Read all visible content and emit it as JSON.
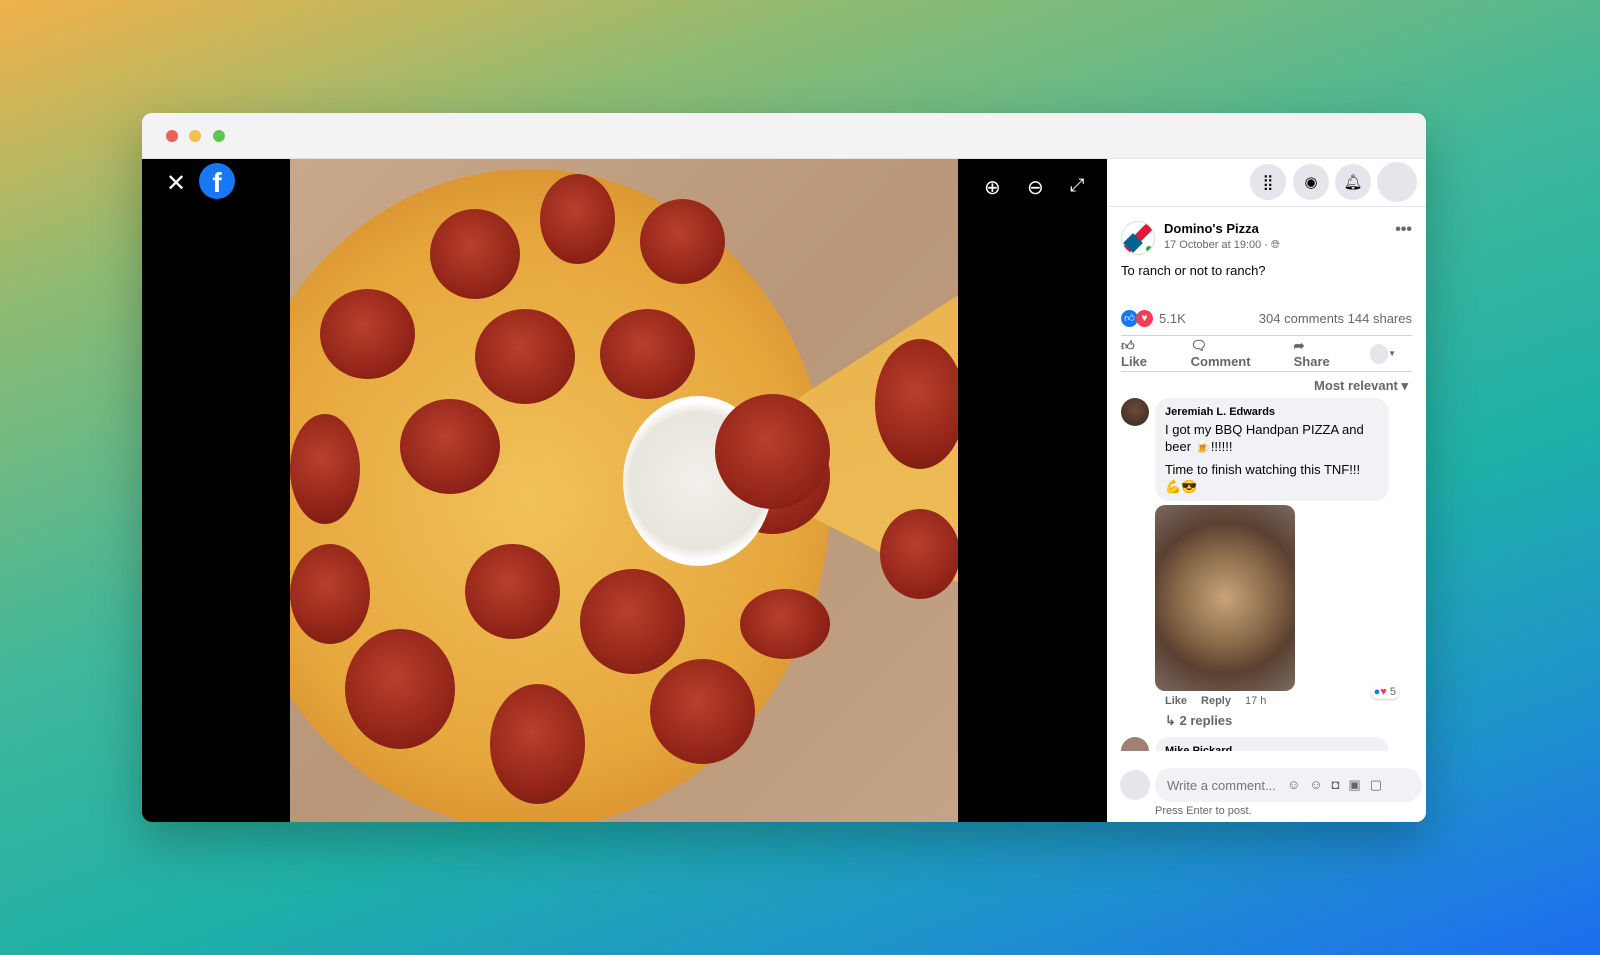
{
  "window": {
    "controls": [
      "close",
      "minimize",
      "maximize"
    ]
  },
  "viewer": {
    "close_icon": "close-icon",
    "logo": "facebook-logo",
    "tools": [
      "zoom-in-icon",
      "zoom-out-icon",
      "fullscreen-icon"
    ]
  },
  "topbar": {
    "icons": [
      "menu-grid-icon",
      "messenger-icon",
      "notifications-icon",
      "account-avatar"
    ]
  },
  "post": {
    "author": "Domino's Pizza",
    "date": "17 October at 19:00 · ",
    "privacy": "public-globe-icon",
    "text": "To ranch or not to ranch?",
    "reactions_count": "5.1K",
    "comments": "304 comments",
    "shares": "144 shares",
    "actions": {
      "like": "Like",
      "comment": "Comment",
      "share": "Share"
    }
  },
  "sort": "Most relevant",
  "comments": [
    {
      "author": "Jeremiah L. Edwards",
      "text1": "I got my BBQ Handpan PIZZA and beer 🍺!!!!!!",
      "text2": "Time to finish watching this TNF!!! 💪😎",
      "like": "Like",
      "reply": "Reply",
      "time": "17 h",
      "reactions": "5",
      "replies": "2 replies"
    },
    {
      "author": "Mike Pickard"
    }
  ],
  "composer": {
    "placeholder": "Write a comment...",
    "hint": "Press Enter to post."
  },
  "colors": {
    "fb_blue": "#1877f2",
    "dominos_red": "#e31837",
    "dominos_blue": "#006491"
  }
}
